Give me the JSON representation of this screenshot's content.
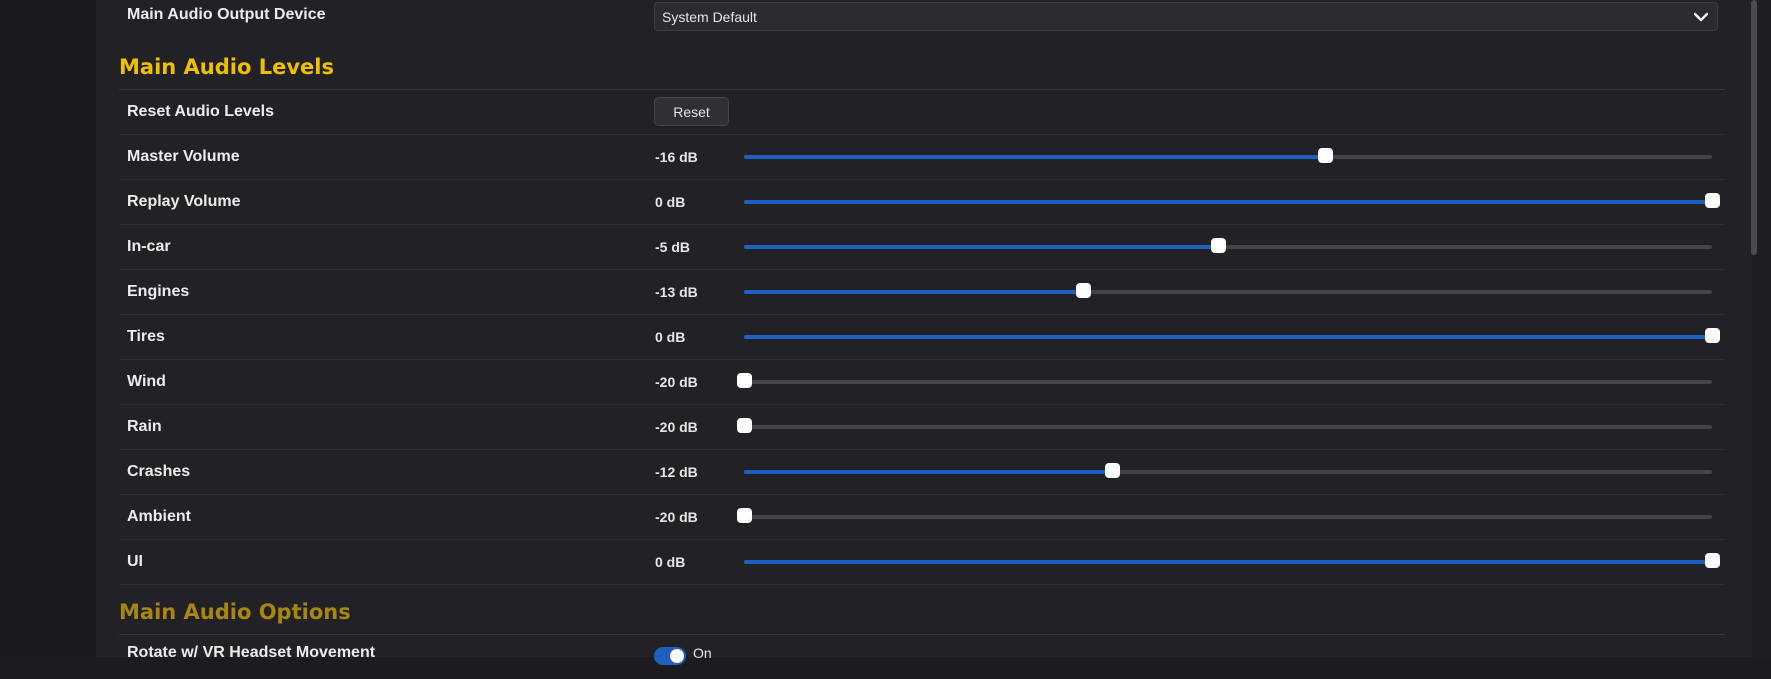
{
  "output_device": {
    "label": "Main Audio Output Device",
    "selected": "System Default"
  },
  "sections": {
    "levels_title": "Main Audio Levels",
    "options_title": "Main Audio Options",
    "levels_title_color": "#f0c000",
    "options_title_color": "#a8870f"
  },
  "reset": {
    "label": "Reset Audio Levels",
    "button": "Reset"
  },
  "levels": [
    {
      "label": "Master Volume",
      "value": "-16 dB",
      "fraction": 0.6
    },
    {
      "label": "Replay Volume",
      "value": "0 dB",
      "fraction": 1.0
    },
    {
      "label": "In-car",
      "value": "-5 dB",
      "fraction": 0.49
    },
    {
      "label": "Engines",
      "value": "-13 dB",
      "fraction": 0.35
    },
    {
      "label": "Tires",
      "value": "0 dB",
      "fraction": 1.0
    },
    {
      "label": "Wind",
      "value": "-20 dB",
      "fraction": 0.0
    },
    {
      "label": "Rain",
      "value": "-20 dB",
      "fraction": 0.0
    },
    {
      "label": "Crashes",
      "value": "-12 dB",
      "fraction": 0.38
    },
    {
      "label": "Ambient",
      "value": "-20 dB",
      "fraction": 0.0
    },
    {
      "label": "UI",
      "value": "0 dB",
      "fraction": 1.0
    }
  ],
  "options": {
    "vr_label": "Rotate w/ VR Headset Movement",
    "vr_state": "On"
  },
  "colors": {
    "accent": "#1f5fbf"
  }
}
